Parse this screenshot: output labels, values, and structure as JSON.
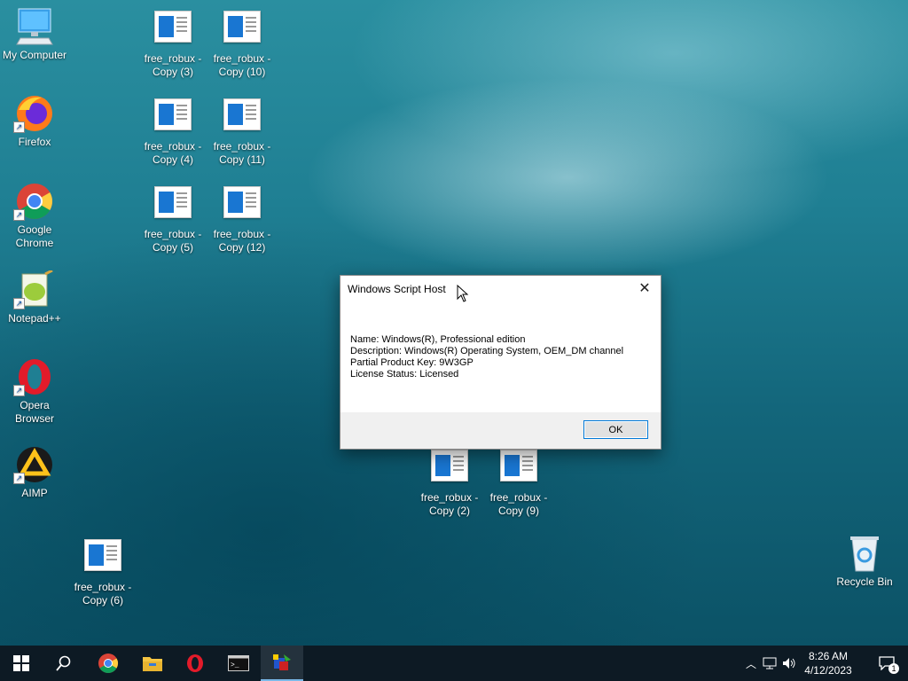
{
  "desktop_icons": [
    {
      "name": "My Computer",
      "label": "My Computer"
    },
    {
      "name": "Firefox",
      "label": "Firefox"
    },
    {
      "name": "Google Chrome",
      "label": "Google Chrome"
    },
    {
      "name": "Notepad++",
      "label": "Notepad++"
    },
    {
      "name": "Opera Browser",
      "label": "Opera Browser"
    },
    {
      "name": "AIMP",
      "label": "AIMP"
    },
    {
      "label": "free_robux - Copy (6)"
    },
    {
      "label": "free_robux - Copy (3)"
    },
    {
      "label": "free_robux - Copy (10)"
    },
    {
      "label": "free_robux - Copy (4)"
    },
    {
      "label": "free_robux - Copy (11)"
    },
    {
      "label": "free_robux - Copy (5)"
    },
    {
      "label": "free_robux - Copy (12)"
    },
    {
      "label": "free_robux - Copy (2)"
    },
    {
      "label": "free_robux - Copy (9)"
    },
    {
      "label": "Recycle Bin"
    }
  ],
  "dialog": {
    "title": "Windows Script Host",
    "lines": [
      "Name: Windows(R), Professional edition",
      "Description: Windows(R) Operating System, OEM_DM channel",
      "Partial Product Key: 9W3GP",
      "License Status: Licensed"
    ],
    "ok_label": "OK"
  },
  "taskbar": {
    "time": "8:26 AM",
    "date": "4/12/2023",
    "notification_count": "1"
  },
  "colors": {
    "accent": "#0078d7",
    "taskbar": "#0d1a24",
    "file_blue": "#1976d2"
  }
}
